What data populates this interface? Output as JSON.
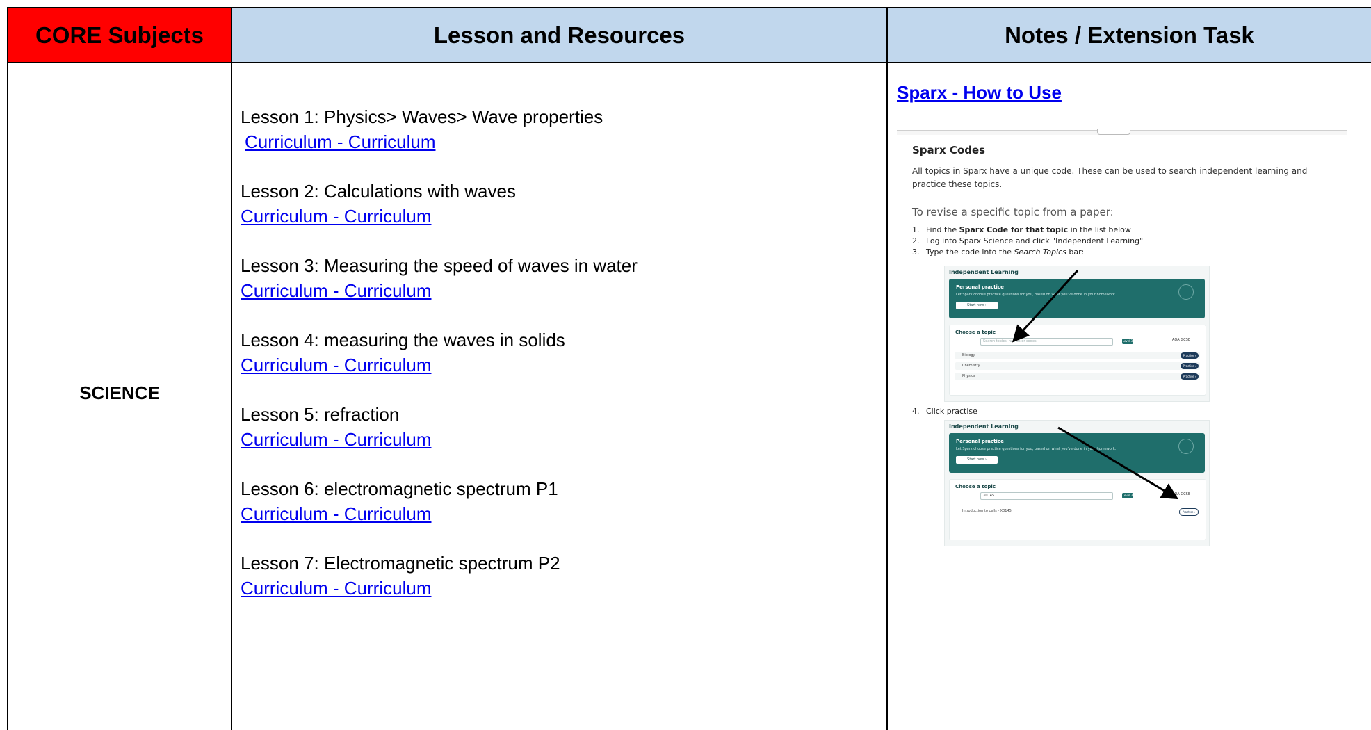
{
  "headers": {
    "core": "CORE Subjects",
    "lesson": "Lesson and Resources",
    "notes": "Notes / Extension Task"
  },
  "colors": {
    "core_header_bg": "#ff0000",
    "header_bg": "#c1d7ed",
    "link": "#0000ee"
  },
  "subject": "SCIENCE",
  "lessons": [
    {
      "title": "Lesson 1:  Physics> Waves> Wave properties",
      "link": "Curriculum - Curriculum"
    },
    {
      "title": "Lesson 2: Calculations with waves",
      "link": "Curriculum - Curriculum"
    },
    {
      "title": "Lesson 3: Measuring the speed of waves in water",
      "link": "Curriculum - Curriculum"
    },
    {
      "title": "Lesson 4: measuring the waves in solids",
      "link": "Curriculum - Curriculum"
    },
    {
      "title": "Lesson 5: refraction",
      "link": "Curriculum - Curriculum"
    },
    {
      "title": "Lesson 6: electromagnetic spectrum P1",
      "link": "Curriculum - Curriculum"
    },
    {
      "title": "Lesson 7: Electromagnetic spectrum P2",
      "link": "Curriculum - Curriculum"
    }
  ],
  "notes": {
    "howto_link": "Sparx - How to Use",
    "embed": {
      "title": "Sparx Codes",
      "description": "All topics in Sparx have a unique code. These can be used to search independent learning and practice these topics.",
      "subheading": "To revise a specific topic from a paper:",
      "steps": [
        {
          "num": "1.",
          "pre": "Find the ",
          "bold": "Sparx Code for that topic",
          "post": " in the list below"
        },
        {
          "num": "2.",
          "pre": "Log into Sparx Science and click \"Independent Learning\"",
          "bold": "",
          "post": ""
        },
        {
          "num": "3.",
          "pre": "Type the code into the ",
          "italic": "Search Topics",
          "post": " bar:"
        }
      ],
      "step4": {
        "num": "4.",
        "text": "Click practise"
      },
      "mini1": {
        "label": "Independent Learning",
        "pp_title": "Personal practice",
        "pp_desc": "Let Sparx choose practice questions for you, based on what you've done in your homework.",
        "pp_button": "Start now  ›",
        "choose": "Choose a topic",
        "search_placeholder": "Search topics, names or codes",
        "level": "Level 3",
        "course": "AQA GCSE",
        "rows": [
          "Biology",
          "Chemistry",
          "Physics"
        ],
        "practise": "Practise  ›"
      },
      "mini2": {
        "label": "Independent Learning",
        "pp_title": "Personal practice",
        "pp_desc": "Let Sparx choose practice questions for you, based on what you've done in your homework.",
        "pp_button": "Start now  ›",
        "choose": "Choose a topic",
        "search_value": "X0145",
        "level": "Level 3",
        "course": "AQA GCSE",
        "rows": [
          "Introduction to cells - X0145"
        ],
        "practise": "Practise  ›"
      }
    }
  }
}
